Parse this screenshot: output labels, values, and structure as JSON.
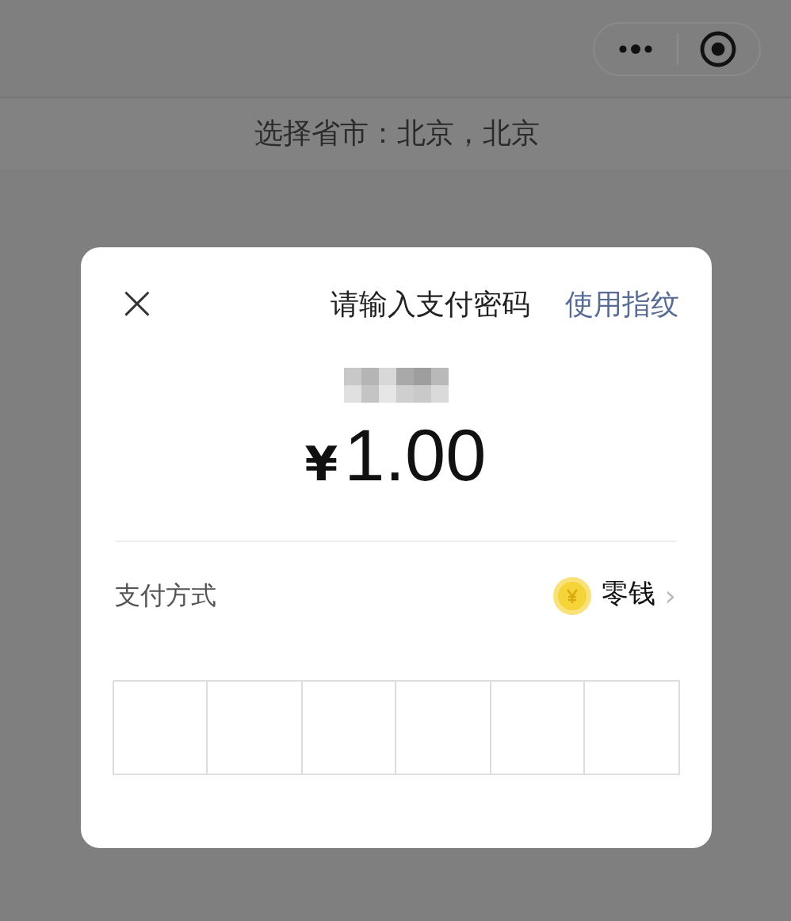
{
  "top_bar": {
    "subtitle": "选择省市：北京，北京"
  },
  "dialog": {
    "close": "×",
    "title": "请输入支付密码",
    "link": "使用指纹",
    "currency": "¥",
    "amount": "1.00",
    "payment_method": {
      "label": "支付方式",
      "value": "零钱",
      "chevron": "›"
    },
    "password_cells": [
      {
        "filled": false
      },
      {
        "filled": false
      },
      {
        "filled": false
      },
      {
        "filled": false
      },
      {
        "filled": false
      },
      {
        "filled": false
      }
    ]
  }
}
